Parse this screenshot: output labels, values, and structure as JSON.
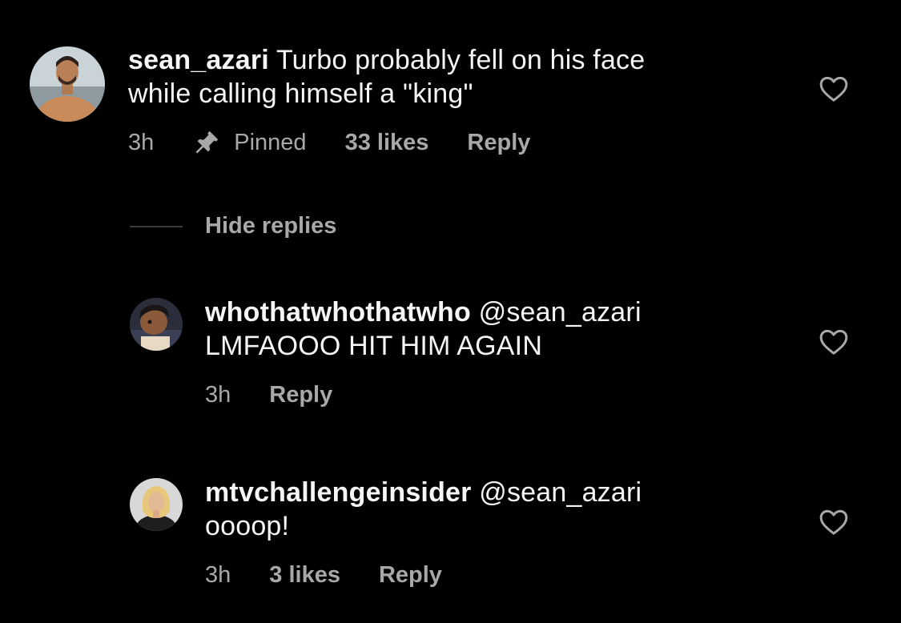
{
  "comments": [
    {
      "username": "sean_azari",
      "text_line1": " Turbo probably fell on his face",
      "text_line2": "while calling himself a \"king\"",
      "time": "3h",
      "pinned_label": "Pinned",
      "likes": "33 likes",
      "reply_label": "Reply"
    }
  ],
  "thread": {
    "hide_replies_label": "Hide replies"
  },
  "replies": [
    {
      "username": "whothatwhothatwho",
      "mention": " @sean_azari",
      "text": "LMFAOOO HIT HIM AGAIN",
      "time": "3h",
      "reply_label": "Reply"
    },
    {
      "username": "mtvchallengeinsider",
      "mention": " @sean_azari",
      "text": "oooop!",
      "time": "3h",
      "likes": "3 likes",
      "reply_label": "Reply"
    }
  ],
  "colors": {
    "background": "#000000",
    "primary_text": "#f5f5f5",
    "secondary_text": "#a8a8a8"
  },
  "icons": {
    "like": "heart-outline-icon",
    "pinned": "pushpin-icon"
  }
}
